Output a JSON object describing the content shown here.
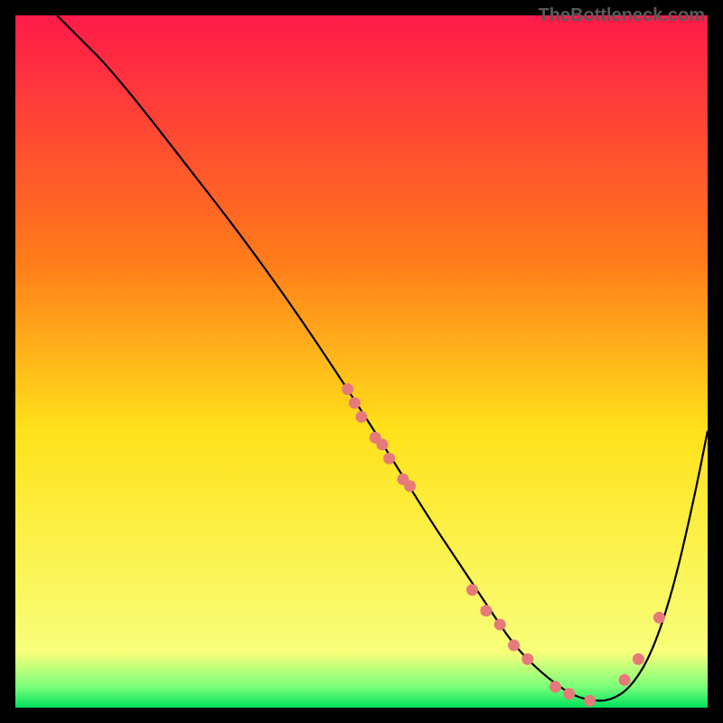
{
  "watermark": "TheBottleneck.com",
  "chart_data": {
    "type": "line",
    "title": "",
    "xlabel": "",
    "ylabel": "",
    "xlim": [
      0,
      100
    ],
    "ylim": [
      0,
      100
    ],
    "gradient_stops": [
      {
        "offset": 0,
        "color": "#ff1a4a"
      },
      {
        "offset": 35,
        "color": "#ff7a1a"
      },
      {
        "offset": 60,
        "color": "#ffe21a"
      },
      {
        "offset": 92,
        "color": "#f8ff7a"
      },
      {
        "offset": 97,
        "color": "#7aff7a"
      },
      {
        "offset": 100,
        "color": "#00e05a"
      }
    ],
    "series": [
      {
        "name": "bottleneck-curve",
        "color": "#000000",
        "x": [
          6,
          8,
          10,
          13,
          18,
          25,
          32,
          40,
          48,
          55,
          60,
          64,
          68,
          72,
          76,
          80,
          83,
          86,
          89,
          92,
          95,
          98,
          100
        ],
        "y": [
          100,
          98,
          96,
          93,
          87,
          78,
          69,
          58,
          46,
          35,
          27,
          21,
          15,
          9,
          5,
          2,
          1,
          1,
          3,
          8,
          17,
          30,
          40
        ]
      }
    ],
    "points": {
      "name": "highlight-dots",
      "color": "#e67a7a",
      "x": [
        48,
        49,
        50,
        52,
        53,
        54,
        56,
        57,
        66,
        68,
        70,
        72,
        74,
        78,
        80,
        83,
        88,
        90,
        93
      ],
      "y": [
        46,
        44,
        42,
        39,
        38,
        36,
        33,
        32,
        17,
        14,
        12,
        9,
        7,
        3,
        2,
        1,
        4,
        7,
        13
      ]
    }
  }
}
